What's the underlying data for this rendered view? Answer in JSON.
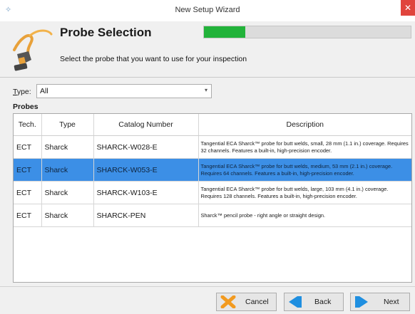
{
  "window": {
    "title": "New Setup Wizard",
    "close_glyph": "✕",
    "app_icon": "wizard-icon"
  },
  "header": {
    "title": "Probe Selection",
    "subtitle": "Select the probe that you want to use for your inspection",
    "progress_fraction": 0.2,
    "progress_color": "#22b33a"
  },
  "filter": {
    "type_label_first": "T",
    "type_label_rest": "ype:",
    "type_value": "All"
  },
  "probes_label": "Probes",
  "table": {
    "columns": [
      "Tech.",
      "Type",
      "Catalog Number",
      "Description"
    ],
    "rows": [
      {
        "tech": "ECT",
        "type": "Sharck",
        "catalog": "SHARCK-W028-E",
        "desc": "Tangential ECA Sharck™ probe for butt welds, small, 28 mm (1.1 in.) coverage. Requires 32 channels. Features a built-in, high-precision encoder."
      },
      {
        "tech": "ECT",
        "type": "Sharck",
        "catalog": "SHARCK-W053-E",
        "desc": "Tangential ECA Sharck™ probe for butt welds, medium, 53 mm (2.1 in.) coverage. Requires 64 channels. Features a built-in, high-precision encoder."
      },
      {
        "tech": "ECT",
        "type": "Sharck",
        "catalog": "SHARCK-W103-E",
        "desc": "Tangential ECA Sharck™ probe for butt welds, large, 103 mm (4.1 in.) coverage. Requires 128 channels. Features a built-in, high-precision encoder."
      },
      {
        "tech": "ECT",
        "type": "Sharck",
        "catalog": "SHARCK-PEN",
        "desc": "Sharck™ pencil probe - right angle or straight design."
      }
    ],
    "selected_row": 1,
    "selection_color": "#3c8fe6"
  },
  "footer": {
    "cancel_label": "Cancel",
    "back_label": "Back",
    "next_label": "Next"
  }
}
